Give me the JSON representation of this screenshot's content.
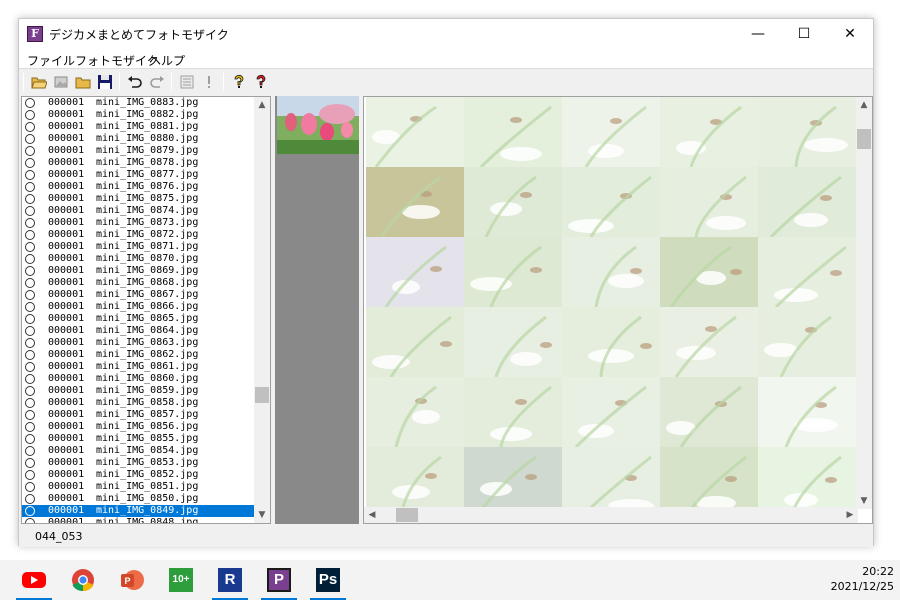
{
  "window": {
    "title": "デジカメまとめてフォトモザイク",
    "app_icon_letter": "F",
    "minimize": "—",
    "maximize": "☐",
    "close": "✕"
  },
  "menu": [
    {
      "label": "ファイル"
    },
    {
      "label": "フォトモザイク"
    },
    {
      "label": "ヘルプ"
    }
  ],
  "toolbar": {
    "icons": [
      "open-folder-icon",
      "image-icon",
      "folder-icon",
      "save-icon",
      "undo-icon",
      "redo-icon",
      "list-icon",
      "exclamation-icon",
      "help-icon",
      "context-help-icon"
    ]
  },
  "file_list": {
    "scroll_position": 0.72,
    "selected_index": 34,
    "rows": [
      {
        "count": "000001",
        "name": "mini_IMG_0883.jpg"
      },
      {
        "count": "000001",
        "name": "mini_IMG_0882.jpg"
      },
      {
        "count": "000001",
        "name": "mini_IMG_0881.jpg"
      },
      {
        "count": "000001",
        "name": "mini_IMG_0880.jpg"
      },
      {
        "count": "000001",
        "name": "mini_IMG_0879.jpg"
      },
      {
        "count": "000001",
        "name": "mini_IMG_0878.jpg"
      },
      {
        "count": "000001",
        "name": "mini_IMG_0877.jpg"
      },
      {
        "count": "000001",
        "name": "mini_IMG_0876.jpg"
      },
      {
        "count": "000001",
        "name": "mini_IMG_0875.jpg"
      },
      {
        "count": "000001",
        "name": "mini_IMG_0874.jpg"
      },
      {
        "count": "000001",
        "name": "mini_IMG_0873.jpg"
      },
      {
        "count": "000001",
        "name": "mini_IMG_0872.jpg"
      },
      {
        "count": "000001",
        "name": "mini_IMG_0871.jpg"
      },
      {
        "count": "000001",
        "name": "mini_IMG_0870.jpg"
      },
      {
        "count": "000001",
        "name": "mini_IMG_0869.jpg"
      },
      {
        "count": "000001",
        "name": "mini_IMG_0868.jpg"
      },
      {
        "count": "000001",
        "name": "mini_IMG_0867.jpg"
      },
      {
        "count": "000001",
        "name": "mini_IMG_0866.jpg"
      },
      {
        "count": "000001",
        "name": "mini_IMG_0865.jpg"
      },
      {
        "count": "000001",
        "name": "mini_IMG_0864.jpg"
      },
      {
        "count": "000001",
        "name": "mini_IMG_0863.jpg"
      },
      {
        "count": "000001",
        "name": "mini_IMG_0862.jpg"
      },
      {
        "count": "000001",
        "name": "mini_IMG_0861.jpg"
      },
      {
        "count": "000001",
        "name": "mini_IMG_0860.jpg"
      },
      {
        "count": "000001",
        "name": "mini_IMG_0859.jpg"
      },
      {
        "count": "000001",
        "name": "mini_IMG_0858.jpg"
      },
      {
        "count": "000001",
        "name": "mini_IMG_0857.jpg"
      },
      {
        "count": "000001",
        "name": "mini_IMG_0856.jpg"
      },
      {
        "count": "000001",
        "name": "mini_IMG_0855.jpg"
      },
      {
        "count": "000001",
        "name": "mini_IMG_0854.jpg"
      },
      {
        "count": "000001",
        "name": "mini_IMG_0853.jpg"
      },
      {
        "count": "000001",
        "name": "mini_IMG_0852.jpg"
      },
      {
        "count": "000001",
        "name": "mini_IMG_0851.jpg"
      },
      {
        "count": "000001",
        "name": "mini_IMG_0850.jpg"
      },
      {
        "count": "000001",
        "name": "mini_IMG_0849.jpg"
      },
      {
        "count": "000001",
        "name": "mini_IMG_0848.jpg"
      }
    ]
  },
  "status": {
    "text": "044_053"
  },
  "mosaic": {
    "tile_colors": [
      "#eaf2e4",
      "#e4efdc",
      "#eef3ea",
      "#e8f1e1",
      "#e6efe0",
      "#c9c59a",
      "#dfead6",
      "#e3eddc",
      "#e6eee0",
      "#e1ebd9",
      "#e4e3ec",
      "#dde9d2",
      "#e7efe2",
      "#cfdcbe",
      "#e6eee0",
      "#e2ecd9",
      "#e7eee2",
      "#e5eddd",
      "#e9f0e3",
      "#e6efdf",
      "#e6eee0",
      "#e4eddb",
      "#e8efe3",
      "#dee8d5",
      "#f1f6ee",
      "#e3ecda",
      "#cfd9d0",
      "#e7efe2",
      "#d7e3c8",
      "#e8f4e2",
      "#d8dccd",
      "#e0e8d8",
      "#e9f0e4",
      "#e4ecdc",
      "#eef3ea"
    ]
  },
  "taskbar": {
    "apps": [
      {
        "icon": "youtube-icon",
        "color": "#ff0000"
      },
      {
        "icon": "chrome-icon",
        "color": "#4285f4"
      },
      {
        "icon": "powerpoint-icon",
        "color": "#d24726"
      },
      {
        "icon": "app-10plus-icon",
        "color": "#2e9e3c",
        "label": "10+"
      },
      {
        "icon": "r-app-icon",
        "color": "#1a3a8f",
        "label": "R"
      },
      {
        "icon": "p-app-icon",
        "color": "#7a3f8f",
        "label": "P"
      },
      {
        "icon": "photoshop-icon",
        "color": "#001e36",
        "label": "Ps"
      }
    ],
    "time": "20:22",
    "date": "2021/12/25"
  }
}
